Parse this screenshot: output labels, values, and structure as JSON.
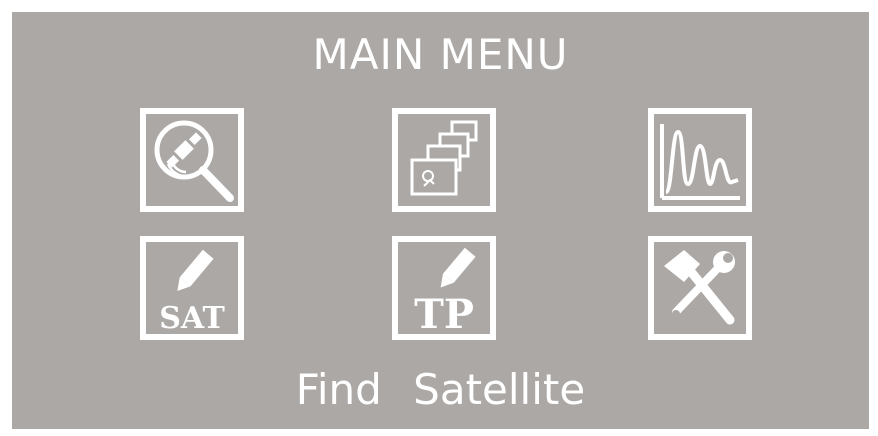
{
  "menu": {
    "title": "MAIN MENU",
    "selected_label": "Find Satellite",
    "items": [
      {
        "id": "find-satellite",
        "icon": "satellite-search-icon"
      },
      {
        "id": "windows",
        "icon": "stacked-windows-icon"
      },
      {
        "id": "spectrum",
        "icon": "spectrum-icon"
      },
      {
        "id": "edit-sat",
        "icon": "edit-sat-icon",
        "text": "SAT"
      },
      {
        "id": "edit-tp",
        "icon": "edit-tp-icon",
        "text": "TP"
      },
      {
        "id": "tools",
        "icon": "tools-icon"
      }
    ]
  },
  "colors": {
    "background": "#aba8a6",
    "foreground": "#ffffff"
  }
}
